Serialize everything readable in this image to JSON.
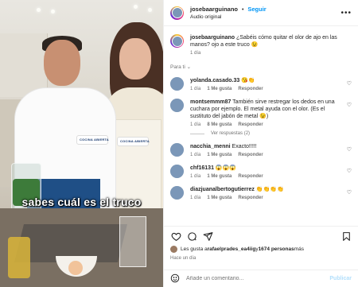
{
  "header": {
    "username": "josebaarguinano",
    "follow_label": "Seguir",
    "audio": "Audio original"
  },
  "video": {
    "caption": "sabes cuál es el truco",
    "badge_text": "COCINA ABIERTA"
  },
  "caption_post": {
    "username": "josebaarguinano",
    "text": " ¿Sabéis cómo quitar el olor de ajo en las manos? ojo a este truco 😉",
    "time": "1 día"
  },
  "para_ti": "Para ti ⌄",
  "comments": [
    {
      "username": "yolanda.casado.33",
      "text": " 😘👏",
      "time": "1 día",
      "likes": "1 Me gusta",
      "reply": "Responder",
      "avatar_color": "#8a6c55"
    },
    {
      "username": "montsemmm87",
      "text": " También sirve restregar los dedos en una cuchara por ejemplo. El metal ayuda con el olor. (Es el sustituto del jabón de metal 😉)",
      "time": "1 día",
      "likes": "8 Me gusta",
      "reply": "Responder",
      "avatar_color": "#3e3e3e",
      "view_replies": "Ver respuestas (2)"
    },
    {
      "username": "nacchia_menni",
      "text": " Exacto!!!!!",
      "time": "1 día",
      "likes": "1 Me gusta",
      "reply": "Responder",
      "avatar_color": "#b19077"
    },
    {
      "username": "chf16131",
      "text": " 😱😱😱",
      "time": "1 día",
      "likes": "1 Me gusta",
      "reply": "Responder",
      "avatar_color": "#5aa0d8"
    },
    {
      "username": "diazjuanalbertogutierrez",
      "text": " 👏👏👏👏",
      "time": "1 día",
      "likes": "1 Me gusta",
      "reply": "Responder",
      "avatar_color": "#8c6a4a"
    }
  ],
  "likes_line": {
    "prefix": "Les gusta a ",
    "user": "rafaelprades_ea4iig",
    "suffix": " y ",
    "count": "1674 personas",
    "end": " más"
  },
  "posted_time": "Hace un día",
  "add_comment": {
    "placeholder": "Añade un comentario...",
    "publish_label": "Publicar"
  }
}
